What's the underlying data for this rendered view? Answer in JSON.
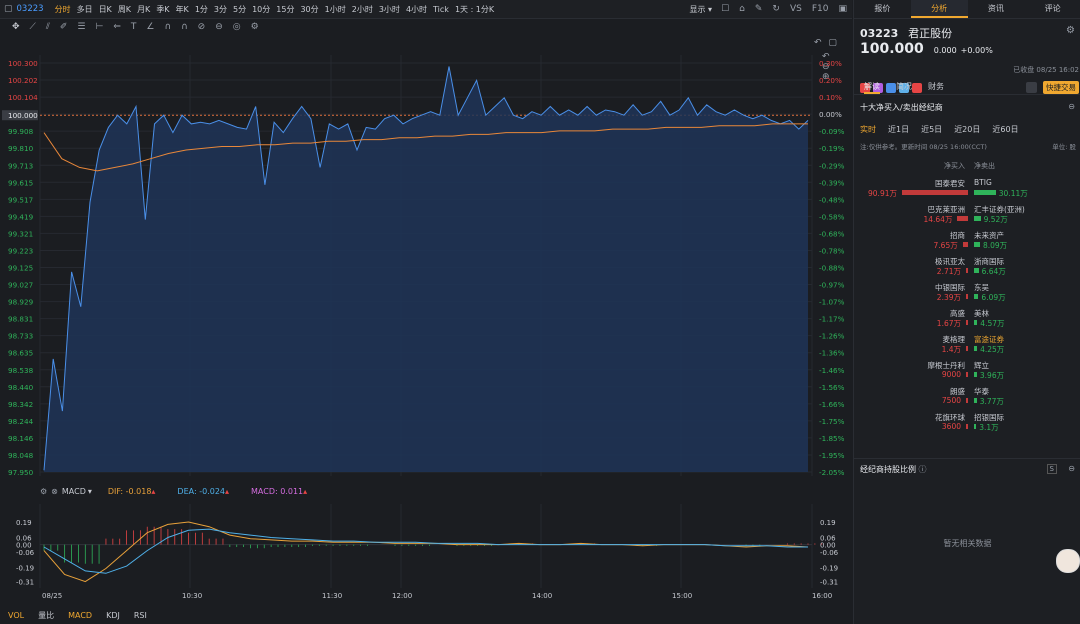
{
  "toolbar": {
    "symbol": "03223",
    "periods": [
      "分时",
      "多日",
      "日K",
      "周K",
      "月K",
      "季K",
      "年K",
      "1分",
      "3分",
      "5分",
      "10分",
      "15分",
      "30分",
      "1小时",
      "2小时",
      "3小时",
      "4小时",
      "Tick",
      "1天 : 1分K"
    ],
    "active_period": "分时",
    "display_label": "显示",
    "vs_label": "VS",
    "f10_label": "F10"
  },
  "chart_data": [
    {
      "type": "line",
      "xlabel": "",
      "ylabel": "",
      "x_ticks": [
        "08/25",
        "10:30",
        "11:30",
        "12:00",
        "14:00",
        "15:00",
        "16:00"
      ],
      "y_ticks_left": [
        "100.300",
        "100.202",
        "100.104",
        "100.000",
        "99.908",
        "99.810",
        "99.713",
        "99.615",
        "99.517",
        "99.419",
        "99.321",
        "99.223",
        "99.125",
        "99.027",
        "98.929",
        "98.831",
        "98.733",
        "98.635",
        "98.538",
        "98.440",
        "98.342",
        "98.244",
        "98.146",
        "98.048",
        "97.950"
      ],
      "y_ticks_right": [
        "0.30%",
        "0.20%",
        "0.10%",
        "0.00%",
        "-0.09%",
        "-0.19%",
        "-0.29%",
        "-0.39%",
        "-0.48%",
        "-0.58%",
        "-0.68%",
        "-0.78%",
        "-0.88%",
        "-0.97%",
        "-1.07%",
        "-1.17%",
        "-1.26%",
        "-1.36%",
        "-1.46%",
        "-1.56%",
        "-1.66%",
        "-1.75%",
        "-1.85%",
        "-1.95%",
        "-2.05%"
      ],
      "ylim": [
        97.95,
        100.3
      ],
      "prev_close": 100.0,
      "series": [
        {
          "role": "price",
          "color": "#4a8fe8",
          "values": [
            97.96,
            98.6,
            98.3,
            99.1,
            98.9,
            99.5,
            99.8,
            99.93,
            100.0,
            99.95,
            100.05,
            99.4,
            99.95,
            100.0,
            99.9,
            100.0,
            99.95,
            99.96,
            99.95,
            99.97,
            99.95,
            99.93,
            99.92,
            100.05,
            99.6,
            99.96,
            99.9,
            99.98,
            100.05,
            99.98,
            99.7,
            99.95,
            99.92,
            99.95,
            99.8,
            99.93,
            99.92,
            99.98,
            100.0,
            99.95,
            99.98,
            100.0,
            100.02,
            100.0,
            100.28,
            100.0,
            100.1,
            100.2,
            100.0,
            100.05,
            100.1,
            100.0,
            99.98,
            100.02,
            100.0,
            100.05,
            100.0,
            100.03,
            100.0,
            100.05,
            100.0,
            100.03,
            100.02,
            100.0,
            100.06,
            100.0,
            100.02,
            100.08,
            100.0,
            100.03,
            100.1,
            100.0,
            100.06,
            100.02,
            100.0,
            100.03,
            100.0,
            99.98,
            100.0,
            99.97,
            99.95,
            99.97,
            99.92,
            99.97
          ]
        },
        {
          "role": "average",
          "color": "#e8873a",
          "values": [
            99.9,
            99.75,
            99.7,
            99.68,
            99.7,
            99.72,
            99.75,
            99.78,
            99.8,
            99.81,
            99.82,
            99.82,
            99.83,
            99.83,
            99.84,
            99.84,
            99.85,
            99.85,
            99.86,
            99.86,
            99.87,
            99.87,
            99.88,
            99.88,
            99.89,
            99.89,
            99.9,
            99.9,
            99.9,
            99.91,
            99.91,
            99.91,
            99.92,
            99.92,
            99.92,
            99.93,
            99.93,
            99.93,
            99.94,
            99.94,
            99.94,
            99.95,
            99.95,
            99.95
          ]
        }
      ]
    },
    {
      "type": "line",
      "indicator": "MACD",
      "dif_label": "DIF: -0.018",
      "dea_label": "DEA: -0.024",
      "macd_label": "MACD: 0.011",
      "y_ticks": [
        "0.19",
        "0.06",
        "0.00",
        "-0.06",
        "-0.19",
        "-0.31"
      ],
      "ylim": [
        -0.33,
        0.24
      ],
      "series": [
        {
          "name": "DIF",
          "color": "#e8a13a",
          "values": [
            -0.05,
            -0.25,
            -0.31,
            -0.2,
            -0.05,
            0.1,
            0.17,
            0.19,
            0.15,
            0.08,
            0.05,
            0.04,
            0.03,
            0.03,
            0.02,
            0.02,
            0.02,
            0.01,
            0.01,
            0.01,
            0.0,
            0.0,
            0.0,
            0.01,
            0.0,
            0.0,
            0.01,
            0.0,
            0.0,
            -0.01,
            0.0,
            0.0,
            0.0,
            -0.01,
            -0.02,
            -0.01,
            -0.01,
            -0.02
          ]
        },
        {
          "name": "DEA",
          "color": "#4fb0e8",
          "values": [
            -0.02,
            -0.12,
            -0.22,
            -0.24,
            -0.18,
            -0.05,
            0.06,
            0.12,
            0.13,
            0.1,
            0.08,
            0.06,
            0.05,
            0.04,
            0.03,
            0.03,
            0.02,
            0.02,
            0.02,
            0.01,
            0.01,
            0.01,
            0.0,
            0.0,
            0.0,
            0.0,
            0.0,
            0.0,
            0.0,
            0.0,
            0.0,
            0.0,
            0.0,
            -0.01,
            -0.01,
            -0.01,
            -0.02,
            -0.02
          ]
        }
      ],
      "histogram": [
        -0.05,
        -0.15,
        -0.16,
        0.05,
        0.12,
        0.15,
        0.13,
        0.1,
        0.05,
        -0.02,
        -0.03,
        -0.02,
        -0.02,
        -0.01,
        -0.01,
        -0.01,
        0.0,
        -0.01,
        -0.01,
        0.0,
        -0.01,
        -0.01,
        0.0,
        0.01,
        0.0,
        0.0,
        0.01,
        0.0,
        0.0,
        -0.01,
        0.0,
        0.0,
        0.0,
        0.0,
        -0.01,
        0.0,
        0.01,
        0.01
      ]
    }
  ],
  "chart_tools": {
    "indicator_label": "MACD"
  },
  "bottom_tabs": [
    "VOL",
    "量比",
    "MACD",
    "KDJ",
    "RSI"
  ],
  "bottom_active": [
    "VOL",
    "MACD"
  ],
  "right": {
    "tabs": [
      "报价",
      "分析",
      "资讯",
      "评论"
    ],
    "active_tab": "分析",
    "code": "03223",
    "name": "君正股份",
    "price": "100.000",
    "change": "0.000",
    "change_pct": "+0.00%",
    "close_time": "已收盘 08/25 16:02",
    "quick_trade": "快捷交易",
    "sub_tabs": [
      "解读",
      "简况",
      "财务"
    ],
    "active_sub_tab": "解读",
    "section_title": "十大净买入/卖出经纪商",
    "period_tabs": [
      "实时",
      "近1日",
      "近5日",
      "近20日",
      "近60日"
    ],
    "active_period_tab": "实时",
    "note": "注:仅供参考。更新时间 08/25 16:00(CCT)",
    "unit": "单位: 股",
    "col_buy": "净买入",
    "col_sell": "净卖出",
    "brokers": [
      {
        "buy_name": "国泰君安",
        "buy_val": "90.91万",
        "buy_frac": 1.0,
        "sell_name": "BTIG",
        "sell_val": "30.11万",
        "sell_frac": 0.33,
        "sell_color": "#c7cad1"
      },
      {
        "buy_name": "巴克莱亚洲",
        "buy_val": "14.64万",
        "buy_frac": 0.16,
        "sell_name": "汇丰证券(亚洲)",
        "sell_val": "9.52万",
        "sell_frac": 0.1,
        "sell_color": "#c7cad1"
      },
      {
        "buy_name": "招商",
        "buy_val": "7.65万",
        "buy_frac": 0.08,
        "sell_name": "未来资产",
        "sell_val": "8.09万",
        "sell_frac": 0.09,
        "sell_color": "#c7cad1"
      },
      {
        "buy_name": "极讯亚太",
        "buy_val": "2.71万",
        "buy_frac": 0.03,
        "sell_name": "浙商国际",
        "sell_val": "6.64万",
        "sell_frac": 0.07,
        "sell_color": "#c7cad1"
      },
      {
        "buy_name": "中银国际",
        "buy_val": "2.39万",
        "buy_frac": 0.026,
        "sell_name": "东吴",
        "sell_val": "6.09万",
        "sell_frac": 0.067,
        "sell_color": "#c7cad1"
      },
      {
        "buy_name": "高盛",
        "buy_val": "1.67万",
        "buy_frac": 0.018,
        "sell_name": "美林",
        "sell_val": "4.57万",
        "sell_frac": 0.05,
        "sell_color": "#c7cad1"
      },
      {
        "buy_name": "麦格理",
        "buy_val": "1.4万",
        "buy_frac": 0.015,
        "sell_name": "富途证券",
        "sell_val": "4.25万",
        "sell_frac": 0.047,
        "sell_color": "#f0a830"
      },
      {
        "buy_name": "摩根士丹利",
        "buy_val": "9000",
        "buy_frac": 0.01,
        "sell_name": "辉立",
        "sell_val": "3.96万",
        "sell_frac": 0.044,
        "sell_color": "#c7cad1"
      },
      {
        "buy_name": "朗盛",
        "buy_val": "7500",
        "buy_frac": 0.008,
        "sell_name": "华泰",
        "sell_val": "3.77万",
        "sell_frac": 0.041,
        "sell_color": "#c7cad1"
      },
      {
        "buy_name": "花旗环球",
        "buy_val": "3600",
        "buy_frac": 0.004,
        "sell_name": "招银国际",
        "sell_val": "3.1万",
        "sell_frac": 0.034,
        "sell_color": "#c7cad1"
      }
    ],
    "holding_title": "经纪商持股比例",
    "no_data": "暂无相关数据"
  }
}
